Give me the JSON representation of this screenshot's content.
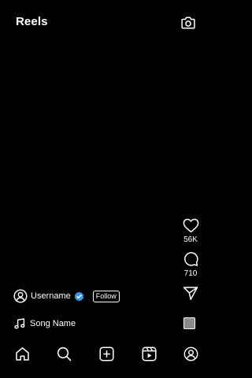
{
  "header": {
    "title": "Reels",
    "camera_icon": "camera-icon"
  },
  "actions": {
    "likes_count": "56K",
    "comments_count": "710",
    "like_icon": "heart-icon",
    "comment_icon": "comment-icon",
    "share_icon": "paper-plane-icon"
  },
  "post": {
    "username": "Username",
    "follow_label": "Follow",
    "verified": true,
    "song_name": "Song Name"
  },
  "nav": {
    "items": [
      {
        "name": "home",
        "icon": "home-icon"
      },
      {
        "name": "search",
        "icon": "search-icon"
      },
      {
        "name": "create",
        "icon": "plus-square-icon"
      },
      {
        "name": "reels",
        "icon": "reels-icon"
      },
      {
        "name": "profile",
        "icon": "profile-icon"
      }
    ]
  },
  "colors": {
    "background": "#000000",
    "foreground": "#ffffff",
    "verified": "#3897f0",
    "audio_thumb": "#8a8a8a"
  }
}
